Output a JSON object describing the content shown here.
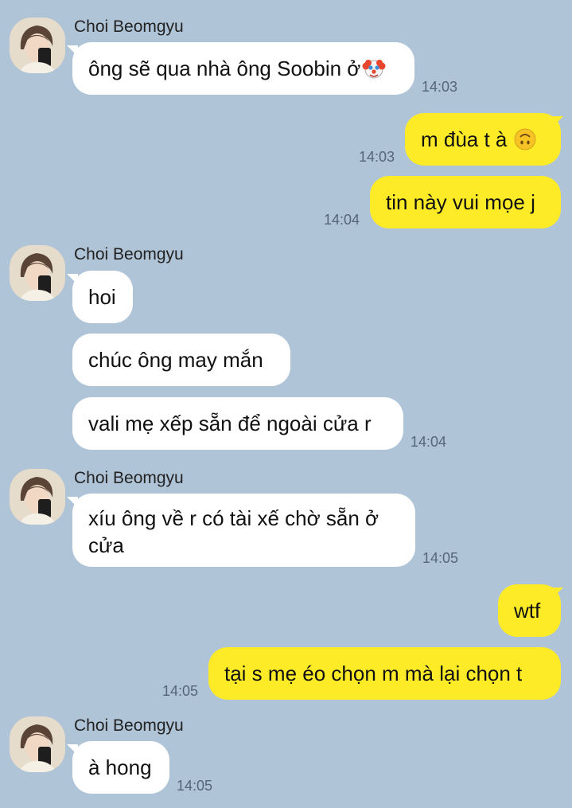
{
  "contact": {
    "name": "Choi Beomgyu"
  },
  "messages": [
    {
      "side": "in",
      "text": "ông sẽ qua nhà ông Soobin ở",
      "emoji": "clown-face-icon",
      "time": "14:03"
    },
    {
      "side": "out",
      "text": "m đùa t à",
      "emoji": "upside-down-face-icon",
      "time": "14:03"
    },
    {
      "side": "out",
      "text": "tin này vui mọe j",
      "time": "14:04"
    },
    {
      "side": "in",
      "text": "hoi"
    },
    {
      "side": "in",
      "text": "chúc ông may mắn"
    },
    {
      "side": "in",
      "text": "vali mẹ xếp sẵn để ngoài cửa r",
      "time": "14:04"
    },
    {
      "side": "in",
      "text": "xíu ông về r có tài xế chờ sẵn ở cửa",
      "time": "14:05"
    },
    {
      "side": "out",
      "text": "wtf"
    },
    {
      "side": "out",
      "text": "tại s mẹ éo chọn m mà lại chọn t",
      "time": "14:05"
    },
    {
      "side": "in",
      "text": "à hong",
      "time": "14:05"
    }
  ],
  "colors": {
    "background": "#b0c4d8",
    "incoming": "#ffffff",
    "outgoing": "#fdeb28"
  }
}
